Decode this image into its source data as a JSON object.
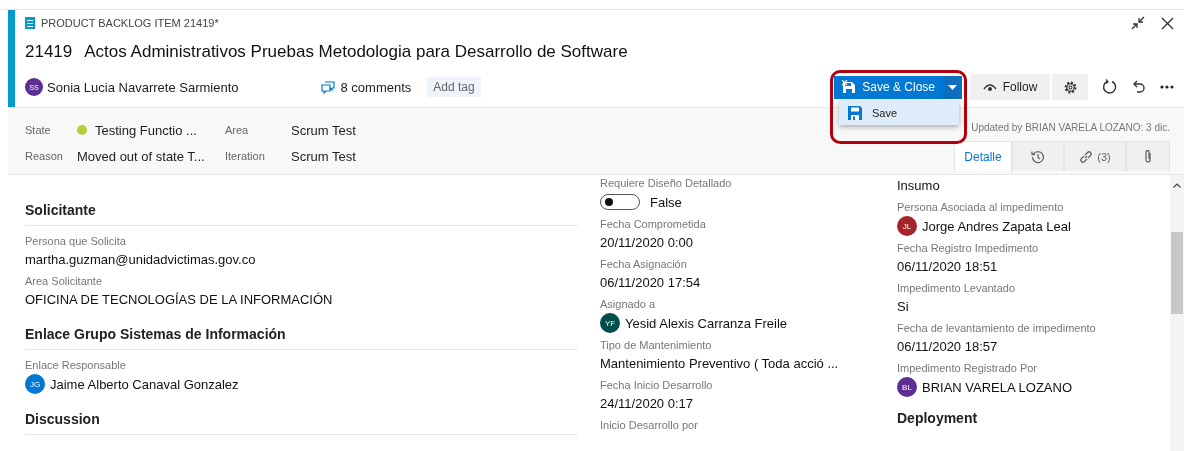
{
  "header": {
    "type_label": "PRODUCT BACKLOG ITEM 21419*",
    "id": "21419",
    "title": "Actos Administrativos Pruebas Metodologia para Desarrollo de Software",
    "author": {
      "initials": "SS",
      "name": "Sonia Lucia Navarrete Sarmiento",
      "color": "#5c2e91"
    },
    "comments": "8 comments",
    "add_tag": "Add tag"
  },
  "toolbar": {
    "save_close": "Save & Close",
    "follow": "Follow"
  },
  "dropdown": {
    "items": [
      {
        "label": "Save",
        "highlighted": true
      }
    ]
  },
  "fields": [
    {
      "label": "State",
      "value": "Testing Functio ...",
      "color": "#b4cf3e"
    },
    {
      "label": "Area",
      "value": "Scrum Test"
    },
    {
      "label": "Reason",
      "value": "Moved out of state T..."
    },
    {
      "label": "Iteration",
      "value": "Scrum Test"
    }
  ],
  "updated": "Updated by BRIAN VARELA LOZANO: 3 dic.",
  "tabs": [
    {
      "kind": "text",
      "label": "Detalle",
      "selected": true
    },
    {
      "kind": "history",
      "selected": false
    },
    {
      "kind": "links",
      "label": "(3)",
      "selected": false
    },
    {
      "kind": "attachment",
      "selected": false
    }
  ],
  "left_sections": [
    {
      "heading": "Solicitante",
      "fields": [
        {
          "kind": "text",
          "label": "Persona que Solicita",
          "value": "martha.guzman@unidadvictimas.gov.co"
        },
        {
          "kind": "text",
          "label": "Area Solicitante",
          "value": "OFICINA DE TECNOLOGÍAS DE LA INFORMACIÓN"
        }
      ]
    },
    {
      "heading": "Enlace Grupo Sistemas de Información",
      "fields": [
        {
          "kind": "person",
          "label": "Enlace Responsable",
          "value": "Jaime Alberto Canaval Gonzalez",
          "initials": "JG",
          "color": "#0078d4"
        }
      ]
    },
    {
      "heading": "Discussion"
    }
  ],
  "middle_fields": [
    {
      "kind": "toggle",
      "label": "Requiere Diseño Detallado",
      "value": "False",
      "on": false
    },
    {
      "kind": "text",
      "label": "Fecha Comprometida",
      "value": "20/11/2020 0:00"
    },
    {
      "kind": "text",
      "label": "Fecha Asignación",
      "value": "06/11/2020 17:54"
    },
    {
      "kind": "person",
      "label": "Asignado a",
      "value": "Yesid Alexis Carranza Freile",
      "initials": "YF",
      "color": "#004e4b"
    },
    {
      "kind": "text",
      "label": "Tipo de Mantenimiento",
      "value": "Mantenimiento Preventivo ( Toda acció ..."
    },
    {
      "kind": "text",
      "label": "Fecha Inicio Desarrollo",
      "value": "24/11/2020 0:17"
    },
    {
      "kind": "text",
      "label": "Inicio Desarrollo por"
    }
  ],
  "right_fields": [
    {
      "kind": "text",
      "value": "Insumo"
    },
    {
      "kind": "person",
      "label": "Persona Asociada al impedimento",
      "value": "Jorge Andres Zapata Leal",
      "initials": "JL",
      "color": "#a4262c"
    },
    {
      "kind": "text",
      "label": "Fecha Registro Impedimento",
      "value": "06/11/2020 18:51"
    },
    {
      "kind": "text",
      "label": "Impedimento Levantado",
      "value": "Si"
    },
    {
      "kind": "text",
      "label": "Fecha de levantamiento de impedimento",
      "value": "06/11/2020 18:57"
    },
    {
      "kind": "person",
      "label": "Impedimento Registrado Por",
      "value": "BRIAN VARELA LOZANO",
      "initials": "BL",
      "color": "#5c2e91"
    }
  ],
  "right_heading": "Deployment"
}
